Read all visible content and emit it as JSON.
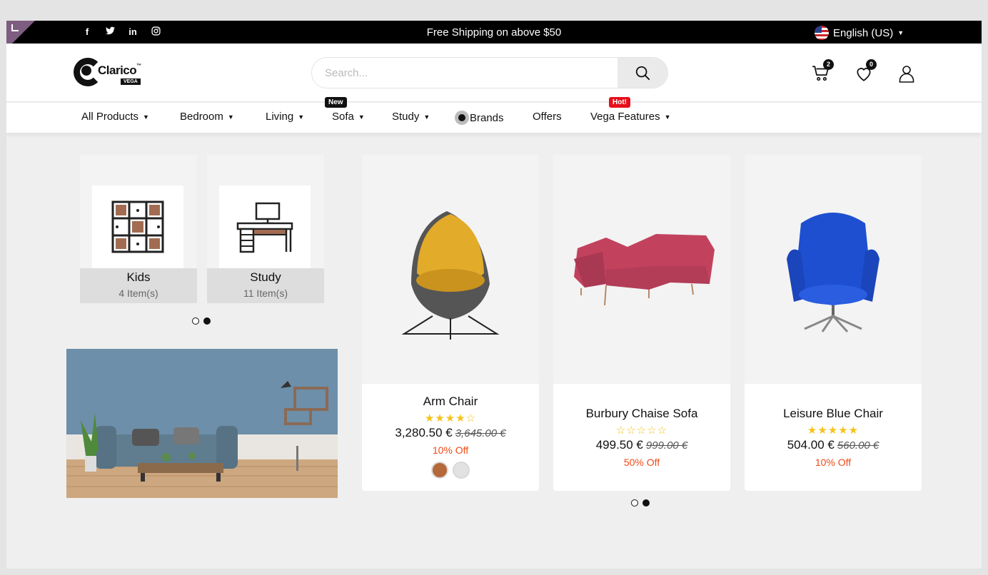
{
  "topbar": {
    "social": [
      {
        "icon": "facebook-icon",
        "glyph": "f"
      },
      {
        "icon": "twitter-icon",
        "glyph": "🐦"
      },
      {
        "icon": "linkedin-icon",
        "glyph": "in"
      },
      {
        "icon": "instagram-icon",
        "glyph": "◎"
      }
    ],
    "promo": "Free Shipping on above $50",
    "language": "English (US)"
  },
  "header": {
    "logo_text": "Clarico",
    "logo_sub": "VEGA",
    "search_placeholder": "Search...",
    "cart_count": "2",
    "wishlist_count": "0"
  },
  "nav": {
    "items": [
      {
        "label": "All Products",
        "dropdown": true
      },
      {
        "label": "Bedroom",
        "dropdown": true
      },
      {
        "label": "Living",
        "dropdown": true
      },
      {
        "label": "Sofa",
        "dropdown": true,
        "tag": "New"
      },
      {
        "label": "Study",
        "dropdown": true
      },
      {
        "label": "Brands",
        "dropdown": false
      },
      {
        "label": "Offers",
        "dropdown": false
      },
      {
        "label": "Vega Features",
        "dropdown": true,
        "tag": "Hot!"
      }
    ]
  },
  "categories": [
    {
      "name": "Kids",
      "count": "4 Item(s)"
    },
    {
      "name": "Study",
      "count": "11 Item(s)"
    }
  ],
  "products": [
    {
      "name": "Arm Chair",
      "stars": "★★★★☆",
      "price": "3,280.50 €",
      "old_price": "3,645.00 €",
      "discount": "10% Off",
      "swatches": [
        "#b5683a",
        "#e2e2e2"
      ]
    },
    {
      "name": "Burbury Chaise Sofa",
      "stars": "☆☆☆☆☆",
      "price": "499.50 €",
      "old_price": "999.00 €",
      "discount": "50% Off"
    },
    {
      "name": "Leisure Blue Chair",
      "stars": "★★★★★",
      "price": "504.00 €",
      "old_price": "560.00 €",
      "discount": "10% Off"
    }
  ],
  "colors": {
    "accent_red": "#f04a16",
    "star": "#f5c218",
    "hot_tag": "#e60f1c"
  }
}
